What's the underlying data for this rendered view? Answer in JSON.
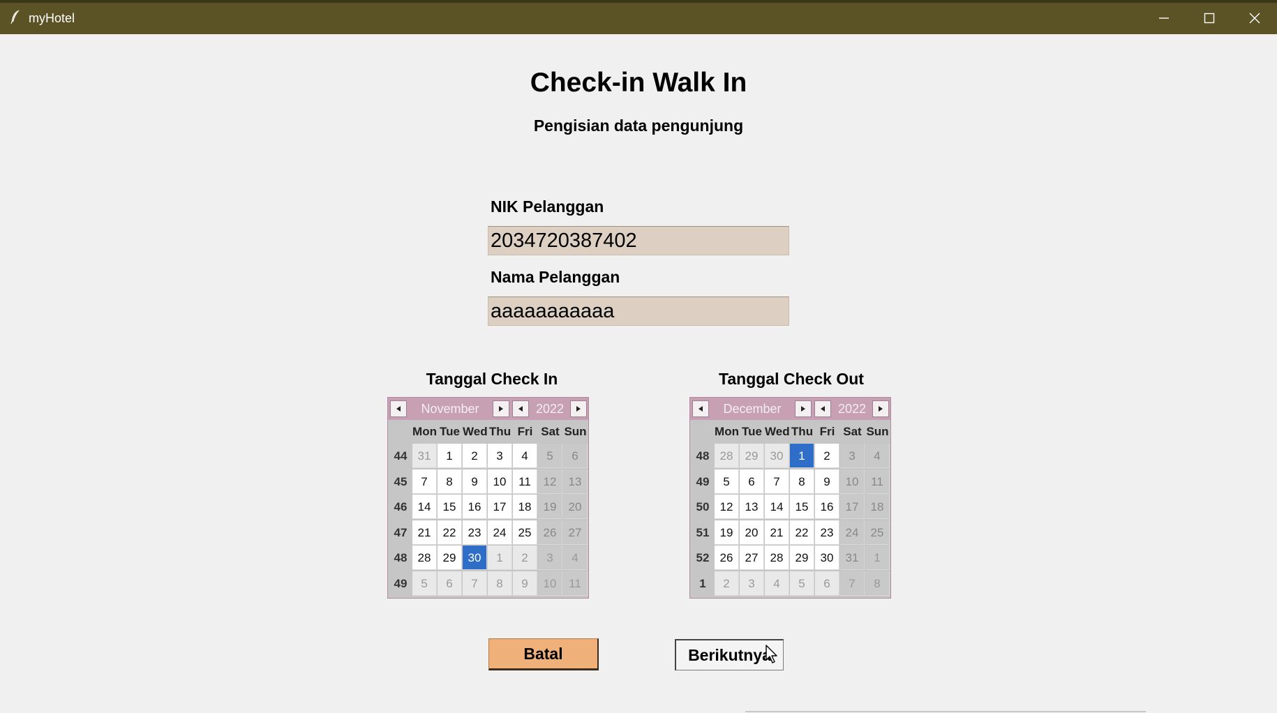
{
  "window": {
    "title": "myHotel"
  },
  "page": {
    "title": "Check-in Walk In",
    "subtitle": "Pengisian data pengunjung"
  },
  "form": {
    "nik_label": "NIK Pelanggan",
    "nik_value": "2034720387402",
    "nama_label": "Nama Pelanggan",
    "nama_value": "aaaaaaaaaaa"
  },
  "calendar_checkin": {
    "label": "Tanggal Check In",
    "month": "November",
    "year": "2022",
    "weekdays": [
      "Mon",
      "Tue",
      "Wed",
      "Thu",
      "Fri",
      "Sat",
      "Sun"
    ],
    "weeks": [
      {
        "num": "44",
        "days": [
          {
            "d": "31",
            "cur": false
          },
          {
            "d": "1",
            "cur": true
          },
          {
            "d": "2",
            "cur": true
          },
          {
            "d": "3",
            "cur": true
          },
          {
            "d": "4",
            "cur": true
          },
          {
            "d": "5",
            "cur": true
          },
          {
            "d": "6",
            "cur": true
          }
        ]
      },
      {
        "num": "45",
        "days": [
          {
            "d": "7",
            "cur": true
          },
          {
            "d": "8",
            "cur": true
          },
          {
            "d": "9",
            "cur": true
          },
          {
            "d": "10",
            "cur": true
          },
          {
            "d": "11",
            "cur": true
          },
          {
            "d": "12",
            "cur": true
          },
          {
            "d": "13",
            "cur": true
          }
        ]
      },
      {
        "num": "46",
        "days": [
          {
            "d": "14",
            "cur": true
          },
          {
            "d": "15",
            "cur": true
          },
          {
            "d": "16",
            "cur": true
          },
          {
            "d": "17",
            "cur": true
          },
          {
            "d": "18",
            "cur": true
          },
          {
            "d": "19",
            "cur": true
          },
          {
            "d": "20",
            "cur": true
          }
        ]
      },
      {
        "num": "47",
        "days": [
          {
            "d": "21",
            "cur": true
          },
          {
            "d": "22",
            "cur": true
          },
          {
            "d": "23",
            "cur": true
          },
          {
            "d": "24",
            "cur": true
          },
          {
            "d": "25",
            "cur": true
          },
          {
            "d": "26",
            "cur": true
          },
          {
            "d": "27",
            "cur": true
          }
        ]
      },
      {
        "num": "48",
        "days": [
          {
            "d": "28",
            "cur": true
          },
          {
            "d": "29",
            "cur": true
          },
          {
            "d": "30",
            "cur": true,
            "selected": true
          },
          {
            "d": "1",
            "cur": false
          },
          {
            "d": "2",
            "cur": false
          },
          {
            "d": "3",
            "cur": false
          },
          {
            "d": "4",
            "cur": false
          }
        ]
      },
      {
        "num": "49",
        "days": [
          {
            "d": "5",
            "cur": false
          },
          {
            "d": "6",
            "cur": false
          },
          {
            "d": "7",
            "cur": false
          },
          {
            "d": "8",
            "cur": false
          },
          {
            "d": "9",
            "cur": false
          },
          {
            "d": "10",
            "cur": false
          },
          {
            "d": "11",
            "cur": false
          }
        ]
      }
    ]
  },
  "calendar_checkout": {
    "label": "Tanggal Check Out",
    "month": "December",
    "year": "2022",
    "weekdays": [
      "Mon",
      "Tue",
      "Wed",
      "Thu",
      "Fri",
      "Sat",
      "Sun"
    ],
    "weeks": [
      {
        "num": "48",
        "days": [
          {
            "d": "28",
            "cur": false
          },
          {
            "d": "29",
            "cur": false
          },
          {
            "d": "30",
            "cur": false
          },
          {
            "d": "1",
            "cur": true,
            "selected": true
          },
          {
            "d": "2",
            "cur": true
          },
          {
            "d": "3",
            "cur": true
          },
          {
            "d": "4",
            "cur": true
          }
        ]
      },
      {
        "num": "49",
        "days": [
          {
            "d": "5",
            "cur": true
          },
          {
            "d": "6",
            "cur": true
          },
          {
            "d": "7",
            "cur": true
          },
          {
            "d": "8",
            "cur": true
          },
          {
            "d": "9",
            "cur": true
          },
          {
            "d": "10",
            "cur": true
          },
          {
            "d": "11",
            "cur": true
          }
        ]
      },
      {
        "num": "50",
        "days": [
          {
            "d": "12",
            "cur": true
          },
          {
            "d": "13",
            "cur": true
          },
          {
            "d": "14",
            "cur": true
          },
          {
            "d": "15",
            "cur": true
          },
          {
            "d": "16",
            "cur": true
          },
          {
            "d": "17",
            "cur": true
          },
          {
            "d": "18",
            "cur": true
          }
        ]
      },
      {
        "num": "51",
        "days": [
          {
            "d": "19",
            "cur": true
          },
          {
            "d": "20",
            "cur": true
          },
          {
            "d": "21",
            "cur": true
          },
          {
            "d": "22",
            "cur": true
          },
          {
            "d": "23",
            "cur": true
          },
          {
            "d": "24",
            "cur": true
          },
          {
            "d": "25",
            "cur": true
          }
        ]
      },
      {
        "num": "52",
        "days": [
          {
            "d": "26",
            "cur": true
          },
          {
            "d": "27",
            "cur": true
          },
          {
            "d": "28",
            "cur": true
          },
          {
            "d": "29",
            "cur": true
          },
          {
            "d": "30",
            "cur": true
          },
          {
            "d": "31",
            "cur": true
          },
          {
            "d": "1",
            "cur": false
          }
        ]
      },
      {
        "num": "1",
        "days": [
          {
            "d": "2",
            "cur": false
          },
          {
            "d": "3",
            "cur": false
          },
          {
            "d": "4",
            "cur": false
          },
          {
            "d": "5",
            "cur": false
          },
          {
            "d": "6",
            "cur": false
          },
          {
            "d": "7",
            "cur": false
          },
          {
            "d": "8",
            "cur": false
          }
        ]
      }
    ]
  },
  "buttons": {
    "batal": "Batal",
    "next": "Berikutnya"
  },
  "icons": {
    "app": "feather-icon",
    "minimize": "minimize-icon",
    "maximize": "maximize-icon",
    "close": "close-icon"
  },
  "colors": {
    "titlebar": "#5b5325",
    "selected_day": "#2f6ec8",
    "batal_button": "#f0b07a",
    "input_bg": "#ddd0c2",
    "calendar_header": "#c7a0b4"
  }
}
